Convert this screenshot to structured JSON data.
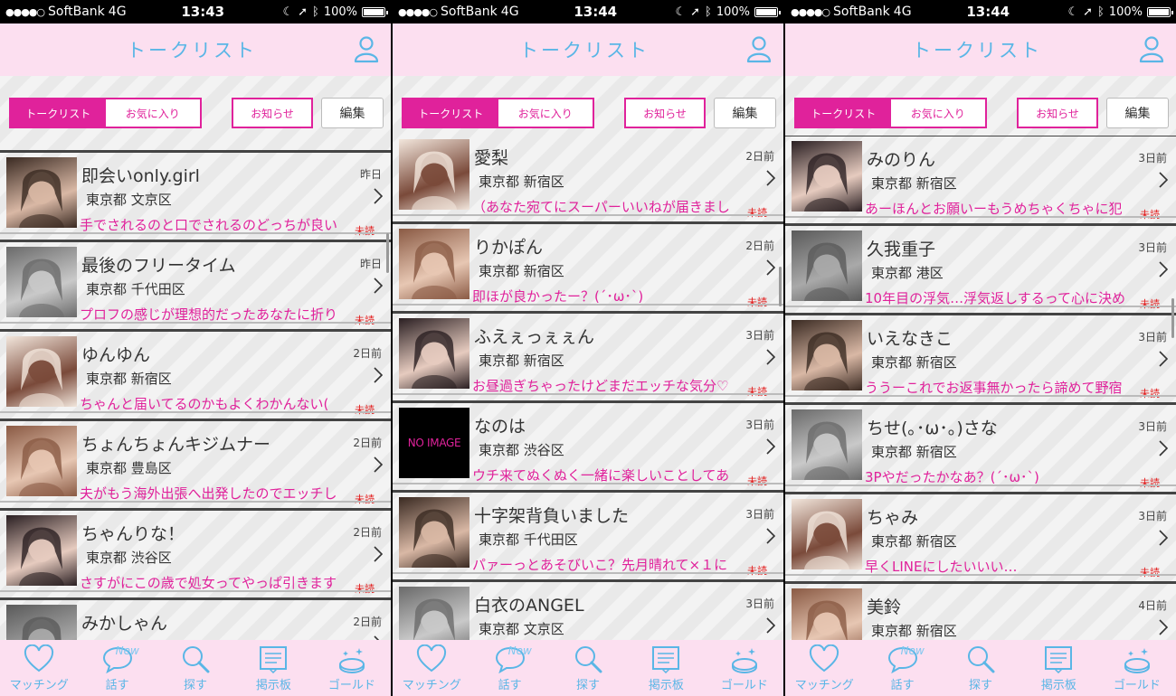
{
  "statusbar": [
    {
      "carrier": "SoftBank",
      "network": "4G",
      "time": "13:43",
      "battery": "100%"
    },
    {
      "carrier": "SoftBank",
      "network": "4G",
      "time": "13:44",
      "battery": "100%"
    },
    {
      "carrier": "SoftBank",
      "network": "4G",
      "time": "13:44",
      "battery": "100%"
    }
  ],
  "navbar": {
    "title": "トークリスト",
    "right_icon": "user-icon"
  },
  "controls": {
    "segment_talk": "トークリスト",
    "segment_fav": "お気に入り",
    "notice": "お知らせ",
    "edit": "編集"
  },
  "colors": {
    "accent": "#e0229b",
    "nav_text": "#5ab6e6",
    "bar_bg": "#fcdff0",
    "unread": "#e21a1a"
  },
  "screens": [
    {
      "rows": [
        {
          "name": "即会いonly.girl",
          "time": "昨日",
          "location": "東京都 文京区",
          "message": "手でされるのと口でされるのどっちが良い",
          "unread": "未読"
        },
        {
          "name": "最後のフリータイム",
          "time": "昨日",
          "location": "東京都 千代田区",
          "message": "プロフの感じが理想的だったあなたに折り",
          "unread": "未読"
        },
        {
          "name": "ゆんゆん",
          "time": "2日前",
          "location": "東京都 新宿区",
          "message": "ちゃんと届いてるのかもよくわかんない(",
          "unread": "未読"
        },
        {
          "name": "ちょんちょんキジムナー",
          "time": "2日前",
          "location": "東京都 豊島区",
          "message": "夫がもう海外出張へ出発したのでエッチし",
          "unread": "未読"
        },
        {
          "name": "ちゃんりな！",
          "time": "2日前",
          "location": "東京都 渋谷区",
          "message": "さすがにこの歳で処女ってやっぱ引きます",
          "unread": "未読"
        },
        {
          "name": "みかしゃん",
          "time": "2日前",
          "location": "東京都 新宿区",
          "message": "",
          "unread": ""
        }
      ]
    },
    {
      "rows": [
        {
          "name": "愛梨",
          "time": "2日前",
          "location": "東京都 新宿区",
          "message": "（あなた宛てにスーパーいいねが届きまし",
          "unread": "未読"
        },
        {
          "name": "りかぽん",
          "time": "2日前",
          "location": "東京都 新宿区",
          "message": "即ほが良かったー？(´･ω･`)",
          "unread": "未読"
        },
        {
          "name": "ふえぇっぇぇん",
          "time": "3日前",
          "location": "東京都 新宿区",
          "message": "お昼過ぎちゃったけどまだエッチな気分♡",
          "unread": "未読"
        },
        {
          "name": "なのは",
          "time": "3日前",
          "location": "東京都 渋谷区",
          "message": "ウチ来てぬくぬく一緒に楽しいことしてあ",
          "unread": "未読",
          "no_image": "NO IMAGE"
        },
        {
          "name": "十字架背負いました",
          "time": "3日前",
          "location": "東京都 千代田区",
          "message": "パァーっとあそびいこ？先月晴れて×１に",
          "unread": "未読"
        },
        {
          "name": "白衣のANGEL",
          "time": "3日前",
          "location": "東京都 文京区",
          "message": "",
          "unread": ""
        }
      ]
    },
    {
      "rows": [
        {
          "name": "みのりん",
          "time": "3日前",
          "location": "東京都 新宿区",
          "message": "あーほんとお願いーもうめちゃくちゃに犯",
          "unread": "未読"
        },
        {
          "name": "久我重子",
          "time": "3日前",
          "location": "東京都 港区",
          "message": "10年目の浮気…浮気返しするって心に決め",
          "unread": "未読"
        },
        {
          "name": "いえなきこ",
          "time": "3日前",
          "location": "東京都 新宿区",
          "message": "ううーこれでお返事無かったら諦めて野宿",
          "unread": "未読"
        },
        {
          "name": "ちせ(｡･ω･｡)さな",
          "time": "3日前",
          "location": "東京都 新宿区",
          "message": "3Pやだったかなあ？(´･ω･`)",
          "unread": "未読"
        },
        {
          "name": "ちゃみ",
          "time": "3日前",
          "location": "東京都 新宿区",
          "message": "早くLINEにしたいいい…",
          "unread": "未読"
        },
        {
          "name": "美鈴",
          "time": "4日前",
          "location": "東京都 新宿区",
          "message": "",
          "unread": ""
        }
      ]
    }
  ],
  "tabbar": {
    "matching": "マッチング",
    "talk": "話す",
    "talk_badge": "New",
    "search": "探す",
    "board": "掲示板",
    "gold": "ゴールド"
  }
}
